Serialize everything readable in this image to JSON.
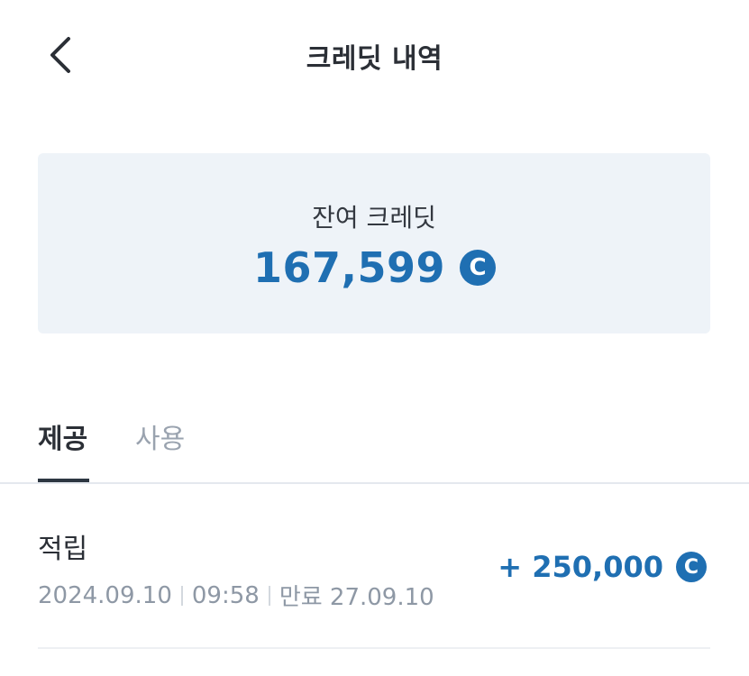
{
  "header": {
    "title": "크레딧 내역",
    "back_icon": "chevron-left-icon"
  },
  "balance": {
    "label": "잔여 크레딧",
    "value": "167,599",
    "currency_symbol": "C"
  },
  "tabs": [
    {
      "label": "제공",
      "active": true
    },
    {
      "label": "사용",
      "active": false
    }
  ],
  "transactions": [
    {
      "type": "적립",
      "date": "2024.09.10",
      "time": "09:58",
      "expiry": "만료 27.09.10",
      "amount": "+ 250,000",
      "currency_symbol": "C"
    }
  ],
  "colors": {
    "accent": "#1f6fb2",
    "card_bg": "#eef3f8",
    "muted": "#8e98a5"
  }
}
